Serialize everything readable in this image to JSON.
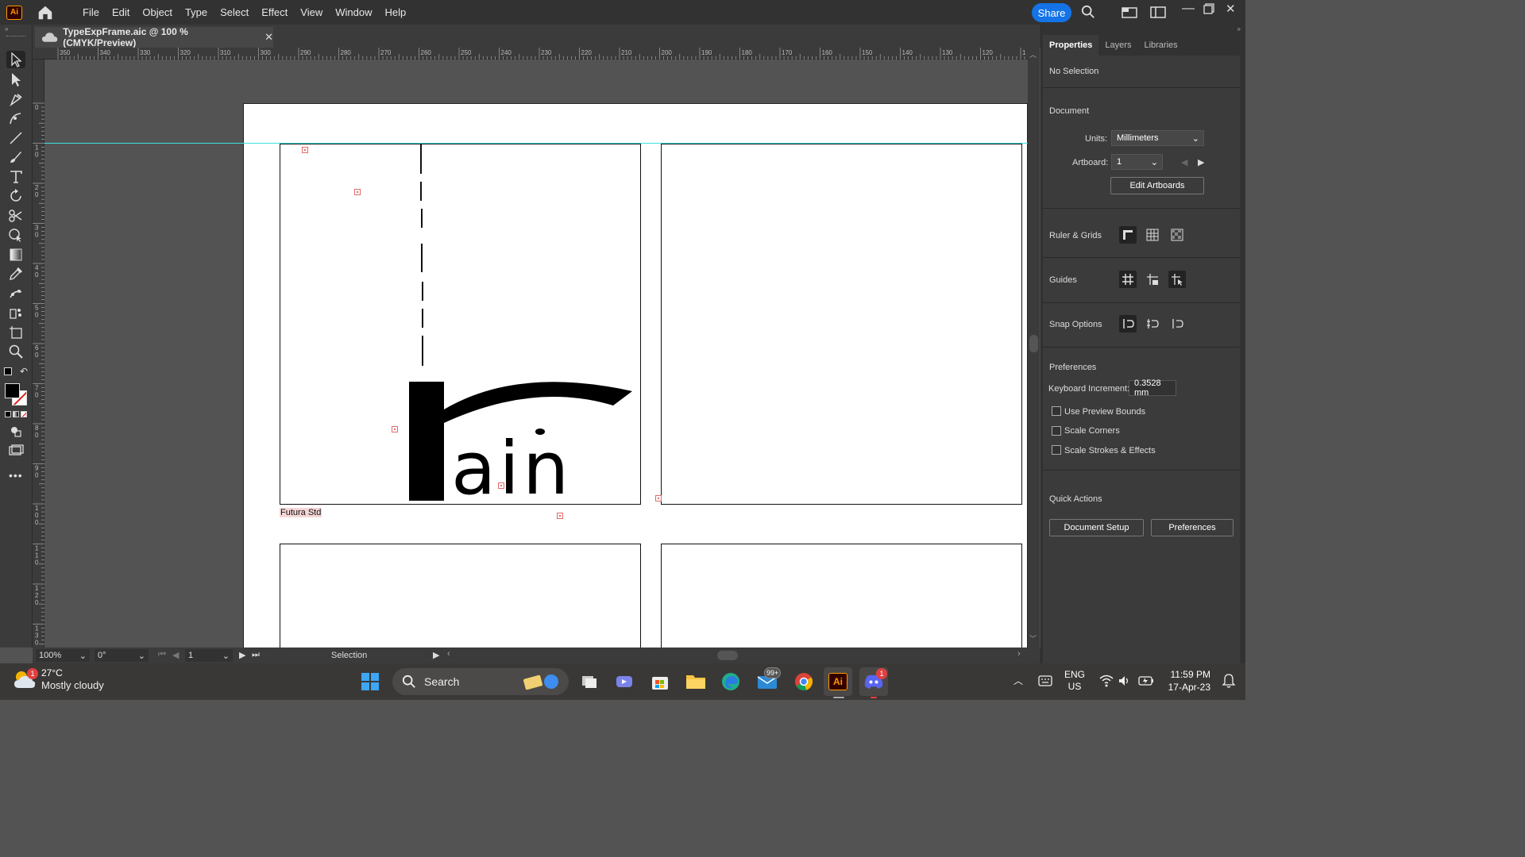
{
  "app": {
    "logo_text": "Ai"
  },
  "menu": [
    "File",
    "Edit",
    "Object",
    "Type",
    "Select",
    "Effect",
    "View",
    "Window",
    "Help"
  ],
  "share_label": "Share",
  "document_tab": {
    "title": "TypeExpFrame.aic @ 100 % (CMYK/Preview)",
    "close": "✕"
  },
  "ruler_h_ticks": [
    "350",
    "340",
    "330",
    "320",
    "310",
    "300",
    "290",
    "280",
    "270",
    "260",
    "250",
    "240",
    "230",
    "220",
    "210",
    "200",
    "190",
    "180",
    "170",
    "160",
    "150",
    "140",
    "130",
    "120",
    "1"
  ],
  "ruler_v_ticks": [
    "0",
    "1 0",
    "2 0",
    "3 0",
    "4 0",
    "5 0",
    "6 0",
    "7 0",
    "8 0",
    "9 0",
    "1 0 0",
    "1 1 0",
    "1 2 0",
    "1 3 0"
  ],
  "artwork": {
    "font_label": "Futura Std",
    "word": "ain"
  },
  "status": {
    "zoom": "100%",
    "rotation": "0°",
    "artboard": "1",
    "tool": "Selection"
  },
  "panel": {
    "tabs": [
      "Properties",
      "Layers",
      "Libraries"
    ],
    "no_selection": "No Selection",
    "document_heading": "Document",
    "units_label": "Units:",
    "units_value": "Millimeters",
    "artboard_label": "Artboard:",
    "artboard_value": "1",
    "edit_artboards": "Edit Artboards",
    "ruler_grids": "Ruler & Grids",
    "guides": "Guides",
    "snap_options": "Snap Options",
    "preferences_heading": "Preferences",
    "keyboard_increment_label": "Keyboard Increment:",
    "keyboard_increment_value": "0.3528 mm",
    "checkboxes": [
      "Use Preview Bounds",
      "Scale Corners",
      "Scale Strokes & Effects"
    ],
    "quick_actions": "Quick Actions",
    "document_setup": "Document Setup",
    "preferences_button": "Preferences"
  },
  "taskbar": {
    "weather_temp": "27°C",
    "weather_desc": "Mostly cloudy",
    "weather_badge": "1",
    "search": "Search",
    "mail_badge": "99+",
    "discord_badge": "1",
    "lang_top": "ENG",
    "lang_bottom": "US",
    "time": "11:59 PM",
    "date": "17-Apr-23"
  }
}
